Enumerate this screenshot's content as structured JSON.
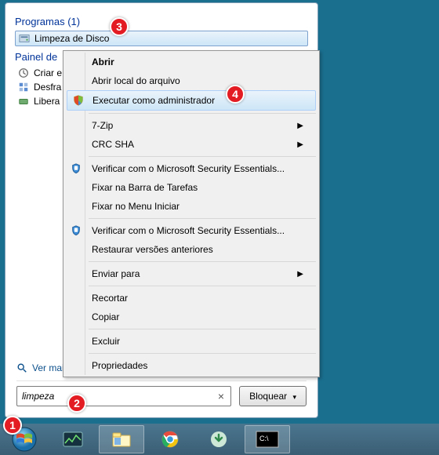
{
  "start_panel": {
    "programs_header": "Programas (1)",
    "programs": [
      {
        "label": "Limpeza de Disco"
      }
    ],
    "control_panel_header": "Painel de",
    "control_panel_items": [
      {
        "label": "Criar e"
      },
      {
        "label": "Desfra"
      },
      {
        "label": "Libera"
      }
    ],
    "see_more": "Ver mais resultados",
    "search_value": "limpeza",
    "lock_label": "Bloquear"
  },
  "context_menu": {
    "items": [
      {
        "label": "Abrir",
        "bold": true
      },
      {
        "label": "Abrir local do arquivo"
      },
      {
        "label": "Executar como administrador",
        "icon": "shield",
        "highlight": true
      },
      {
        "divider": true
      },
      {
        "label": "7-Zip",
        "submenu": true
      },
      {
        "label": "CRC SHA",
        "submenu": true
      },
      {
        "divider": true
      },
      {
        "label": "Verificar com o Microsoft Security Essentials...",
        "icon": "escudo"
      },
      {
        "label": "Fixar na Barra de Tarefas"
      },
      {
        "label": "Fixar no Menu Iniciar"
      },
      {
        "divider": true
      },
      {
        "label": "Verificar com o Microsoft Security Essentials...",
        "icon": "escudo"
      },
      {
        "label": "Restaurar versões anteriores"
      },
      {
        "divider": true
      },
      {
        "label": "Enviar para",
        "submenu": true
      },
      {
        "divider": true
      },
      {
        "label": "Recortar"
      },
      {
        "label": "Copiar"
      },
      {
        "divider": true
      },
      {
        "label": "Excluir"
      },
      {
        "divider": true
      },
      {
        "label": "Propriedades"
      }
    ]
  },
  "callouts": {
    "1": "1",
    "2": "2",
    "3": "3",
    "4": "4"
  }
}
